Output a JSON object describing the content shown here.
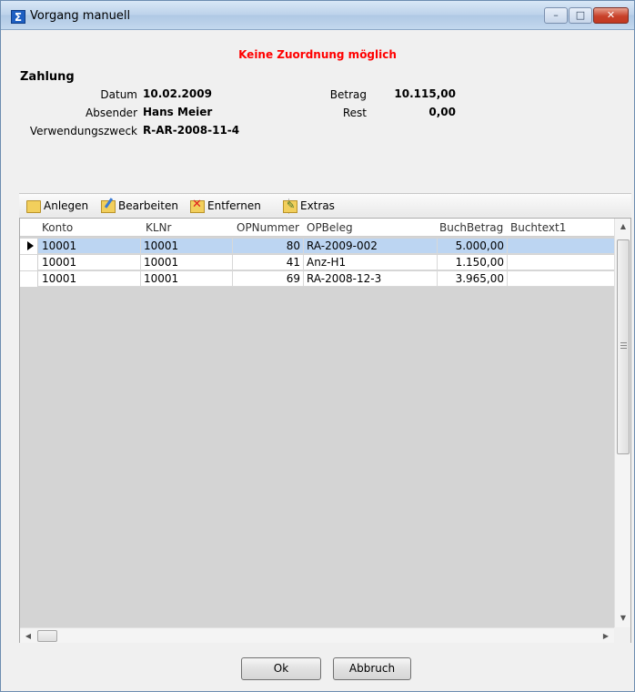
{
  "window": {
    "title": "Vorgang manuell",
    "app_icon_glyph": "Σ",
    "minimize": "–",
    "maximize": "□",
    "close": "✕"
  },
  "status_message": "Keine Zuordnung möglich",
  "payment": {
    "heading": "Zahlung",
    "date_label": "Datum",
    "date_value": "10.02.2009",
    "sender_label": "Absender",
    "sender_value": "Hans Meier",
    "purpose_label": "Verwendungszweck",
    "purpose_value": "R-AR-2008-11-4",
    "amount_label": "Betrag",
    "amount_value": "10.115,00",
    "rest_label": "Rest",
    "rest_value": "0,00"
  },
  "toolbar": {
    "create": "Anlegen",
    "edit": "Bearbeiten",
    "delete": "Entfernen",
    "extras": "Extras"
  },
  "table": {
    "columns": [
      "Konto",
      "KLNr",
      "OPNummer",
      "OPBeleg",
      "BuchBetrag",
      "Buchtext1"
    ],
    "rows": [
      {
        "konto": "10001",
        "klnr": "10001",
        "opnummer": "80",
        "opbeleg": "RA-2009-002",
        "buchbetrag": "5.000,00",
        "buchtext1": ""
      },
      {
        "konto": "10001",
        "klnr": "10001",
        "opnummer": "41",
        "opbeleg": "Anz-H1",
        "buchbetrag": "1.150,00",
        "buchtext1": ""
      },
      {
        "konto": "10001",
        "klnr": "10001",
        "opnummer": "69",
        "opbeleg": "RA-2008-12-3",
        "buchbetrag": "3.965,00",
        "buchtext1": ""
      }
    ],
    "selected_row": 0
  },
  "buttons": {
    "ok": "Ok",
    "cancel": "Abbruch"
  },
  "colors": {
    "status": "#ff0000",
    "selection": "#bcd5f2",
    "grid_background": "#d4d4d4"
  }
}
